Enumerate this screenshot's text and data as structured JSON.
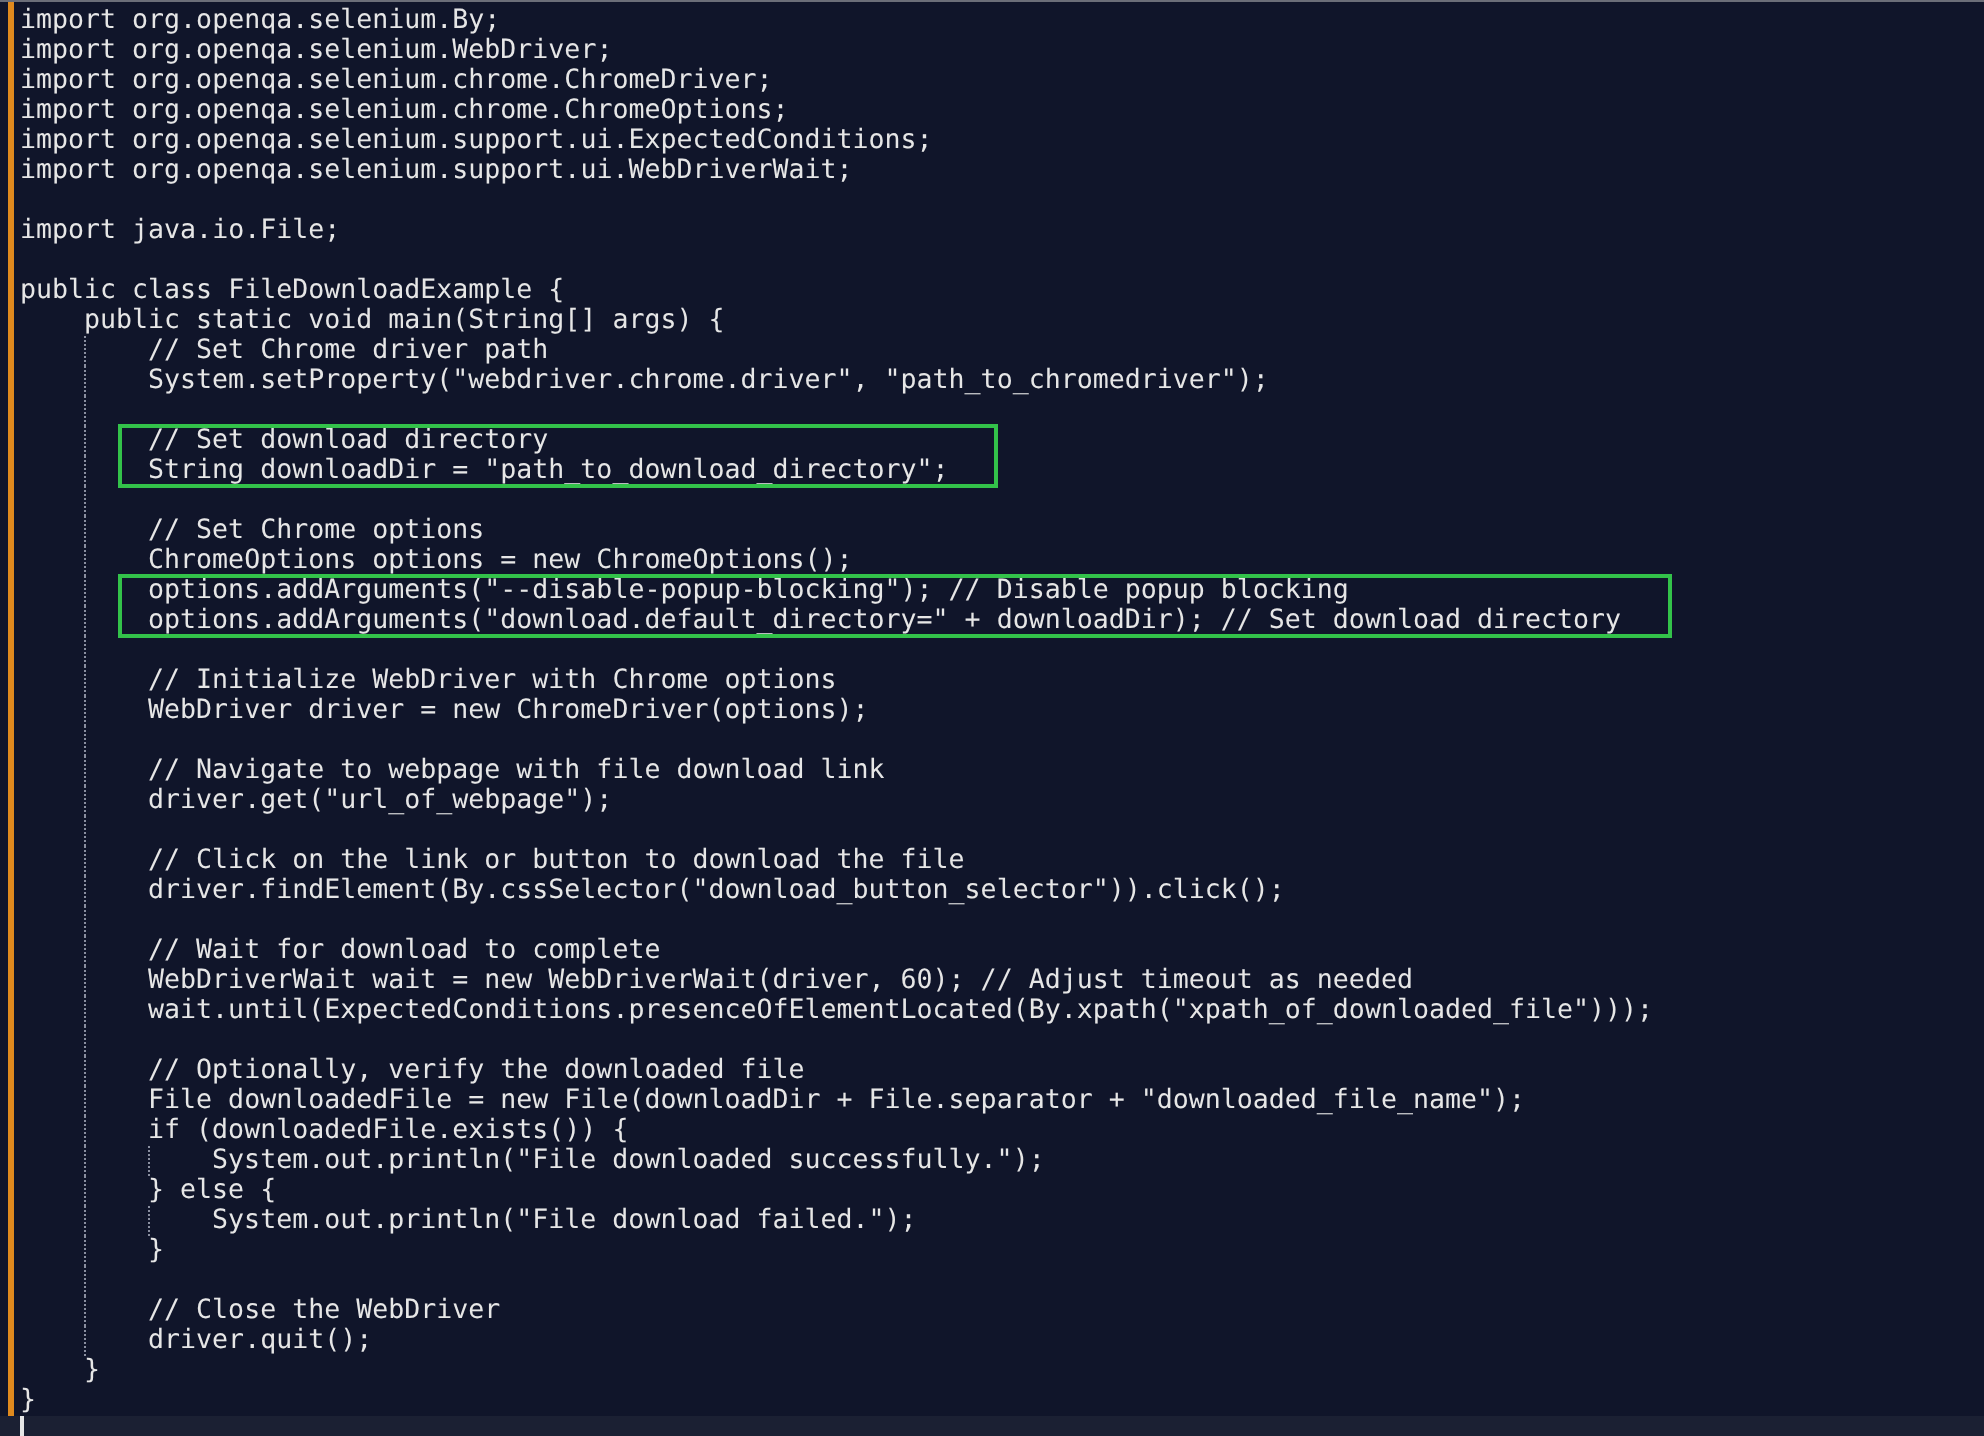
{
  "editor": {
    "segments": [
      {
        "kind": "plain",
        "lines": [
          {
            "kind": "code",
            "text": "import org.openqa.selenium.By;"
          },
          {
            "kind": "code",
            "text": "import org.openqa.selenium.WebDriver;"
          },
          {
            "kind": "code",
            "text": "import org.openqa.selenium.chrome.ChromeDriver;"
          },
          {
            "kind": "code",
            "text": "import org.openqa.selenium.chrome.ChromeOptions;"
          },
          {
            "kind": "code",
            "text": "import org.openqa.selenium.support.ui.ExpectedConditions;"
          },
          {
            "kind": "code",
            "text": "import org.openqa.selenium.support.ui.WebDriverWait;"
          },
          {
            "kind": "blank"
          },
          {
            "kind": "code",
            "text": "import java.io.File;"
          },
          {
            "kind": "blank"
          },
          {
            "kind": "code",
            "text": "public class FileDownloadExample {"
          },
          {
            "kind": "code",
            "text": "    public static void main(String[] args) {"
          },
          {
            "kind": "code",
            "text": "        // Set Chrome driver path"
          },
          {
            "kind": "code",
            "text": "        System.setProperty(\"webdriver.chrome.driver\", \"path_to_chromedriver\");"
          },
          {
            "kind": "blank"
          }
        ]
      },
      {
        "kind": "boxed",
        "lines": [
          {
            "kind": "code",
            "text": "        // Set download directory"
          },
          {
            "kind": "code",
            "text": "        String downloadDir = \"path_to_download_directory\";"
          }
        ]
      },
      {
        "kind": "plain",
        "lines": [
          {
            "kind": "blank"
          },
          {
            "kind": "code",
            "text": "        // Set Chrome options"
          },
          {
            "kind": "code",
            "text": "        ChromeOptions options = new ChromeOptions();"
          }
        ]
      },
      {
        "kind": "boxed",
        "lines": [
          {
            "kind": "code",
            "text": "        options.addArguments(\"--disable-popup-blocking\"); // Disable popup blocking"
          },
          {
            "kind": "code",
            "text": "        options.addArguments(\"download.default_directory=\" + downloadDir); // Set download directory"
          }
        ]
      },
      {
        "kind": "plain",
        "lines": [
          {
            "kind": "blank"
          },
          {
            "kind": "code",
            "text": "        // Initialize WebDriver with Chrome options"
          },
          {
            "kind": "code",
            "text": "        WebDriver driver = new ChromeDriver(options);"
          },
          {
            "kind": "blank"
          },
          {
            "kind": "code",
            "text": "        // Navigate to webpage with file download link"
          },
          {
            "kind": "code",
            "text": "        driver.get(\"url_of_webpage\");"
          },
          {
            "kind": "blank"
          },
          {
            "kind": "code",
            "text": "        // Click on the link or button to download the file"
          },
          {
            "kind": "code",
            "text": "        driver.findElement(By.cssSelector(\"download_button_selector\")).click();"
          },
          {
            "kind": "blank"
          },
          {
            "kind": "code",
            "text": "        // Wait for download to complete"
          },
          {
            "kind": "code",
            "text": "        WebDriverWait wait = new WebDriverWait(driver, 60); // Adjust timeout as needed"
          },
          {
            "kind": "code",
            "text": "        wait.until(ExpectedConditions.presenceOfElementLocated(By.xpath(\"xpath_of_downloaded_file\")));"
          },
          {
            "kind": "blank"
          },
          {
            "kind": "code",
            "text": "        // Optionally, verify the downloaded file"
          },
          {
            "kind": "code",
            "text": "        File downloadedFile = new File(downloadDir + File.separator + \"downloaded_file_name\");"
          },
          {
            "kind": "code",
            "text": "        if (downloadedFile.exists()) {"
          },
          {
            "kind": "code",
            "text": "            System.out.println(\"File downloaded successfully.\");"
          },
          {
            "kind": "code",
            "text": "        } else {"
          },
          {
            "kind": "code",
            "text": "            System.out.println(\"File download failed.\");"
          },
          {
            "kind": "code",
            "text": "        }"
          },
          {
            "kind": "blank"
          },
          {
            "kind": "code",
            "text": "        // Close the WebDriver"
          },
          {
            "kind": "code",
            "text": "        driver.quit();"
          },
          {
            "kind": "code",
            "text": "    }"
          },
          {
            "kind": "code",
            "text": "}"
          }
        ]
      }
    ]
  }
}
